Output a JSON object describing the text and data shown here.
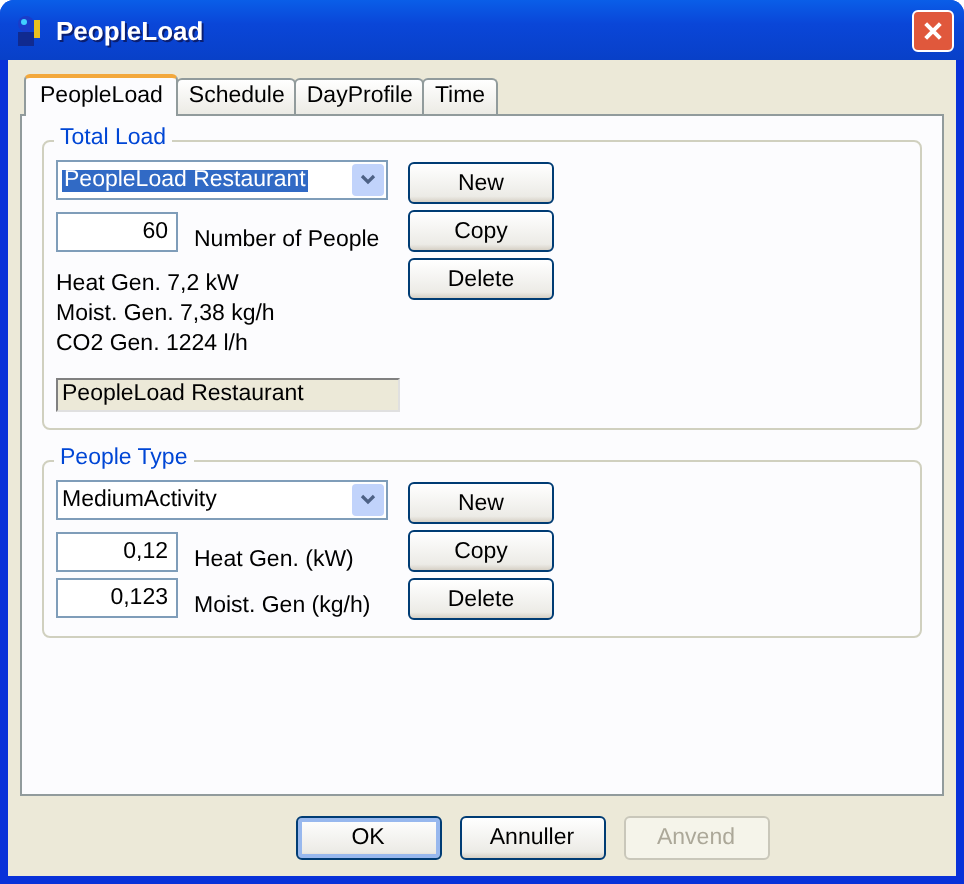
{
  "window": {
    "title": "PeopleLoad"
  },
  "tabs": [
    {
      "label": "PeopleLoad",
      "selected": true
    },
    {
      "label": "Schedule",
      "selected": false
    },
    {
      "label": "DayProfile",
      "selected": false
    },
    {
      "label": "Time",
      "selected": false
    }
  ],
  "total_load": {
    "title": "Total Load",
    "combo": {
      "value": "PeopleLoad Restaurant",
      "highlighted": true
    },
    "fields": [
      {
        "value": "60",
        "label": "Number of People"
      }
    ],
    "info": [
      "Heat Gen. 7,2 kW",
      "Moist. Gen. 7,38 kg/h",
      "CO2 Gen. 1224 l/h"
    ],
    "name_field": {
      "value": "PeopleLoad Restaurant",
      "read_only": true
    },
    "buttons": [
      "New",
      "Copy",
      "Delete"
    ]
  },
  "people_type": {
    "title": "People Type",
    "combo": {
      "value": "MediumActivity",
      "highlighted": false
    },
    "fields": [
      {
        "value": "0,12",
        "label": "Heat Gen. (kW)"
      },
      {
        "value": "0,123",
        "label": "Moist. Gen (kg/h)"
      }
    ],
    "buttons": [
      "New",
      "Copy",
      "Delete"
    ]
  },
  "buttons": [
    {
      "label": "OK",
      "default": true,
      "disabled": false
    },
    {
      "label": "Annuller",
      "default": false,
      "disabled": false
    },
    {
      "label": "Anvend",
      "default": false,
      "disabled": true
    }
  ]
}
